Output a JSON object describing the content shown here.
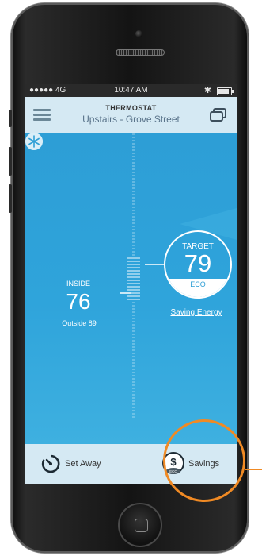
{
  "status_bar": {
    "carrier": "●●●●● 4G",
    "time": "10:47 AM",
    "bluetooth": "✱"
  },
  "header": {
    "title": "THERMOSTAT",
    "subtitle": "Upstairs - Grove Street"
  },
  "inside": {
    "label": "INSIDE",
    "temp": "76",
    "outside": "Outside 89"
  },
  "target": {
    "label": "TARGET",
    "temp": "79",
    "eco": "ECO"
  },
  "saving_link": "Saving Energy",
  "bottom": {
    "set_away": "Set Away",
    "savings": "Savings",
    "savings_symbol": "$",
    "savings_badge": "ECO"
  },
  "colors": {
    "accent": "#2e9fd6",
    "header_bg": "#d5e9f3",
    "highlight": "#f08a24"
  },
  "icons": [
    "menu-icon",
    "device-icon",
    "snowflake-icon",
    "timer-icon",
    "dollar-eco-icon",
    "home-button"
  ]
}
